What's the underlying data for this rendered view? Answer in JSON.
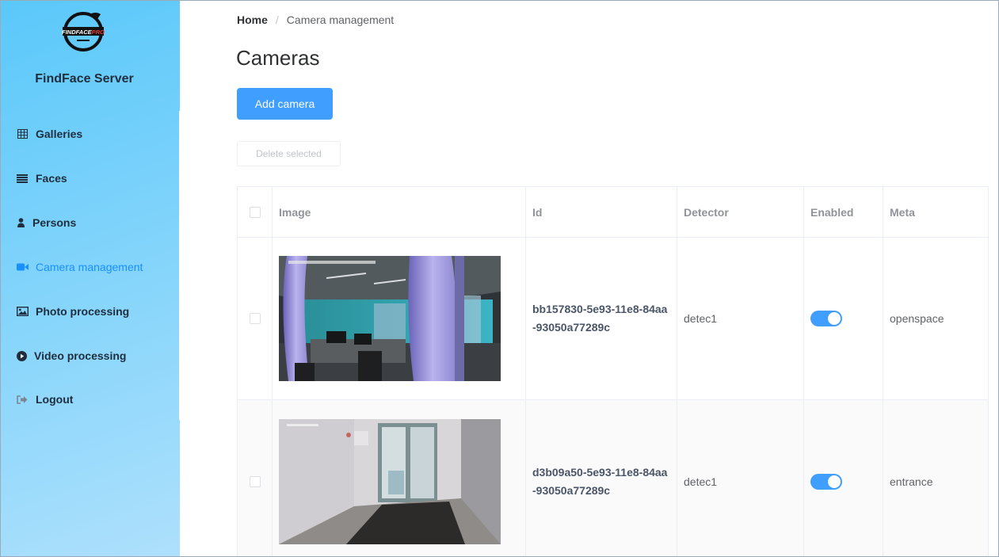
{
  "sidebar": {
    "logo_text": "FINDFACE PRO",
    "brand": "FindFace Server",
    "items": [
      {
        "label": "Galleries",
        "icon": "table-grid-icon",
        "active": false
      },
      {
        "label": "Faces",
        "icon": "list-icon",
        "active": false
      },
      {
        "label": "Persons",
        "icon": "person-icon",
        "active": false
      },
      {
        "label": "Camera management",
        "icon": "video-camera-icon",
        "active": true
      },
      {
        "label": "Photo processing",
        "icon": "image-icon",
        "active": false
      },
      {
        "label": "Video processing",
        "icon": "play-circle-icon",
        "active": false
      },
      {
        "label": "Logout",
        "icon": "sign-out-icon",
        "active": false
      }
    ]
  },
  "breadcrumb": {
    "home": "Home",
    "separator": "/",
    "current": "Camera management"
  },
  "page": {
    "title": "Cameras"
  },
  "actions": {
    "add_camera": "Add camera",
    "delete_selected": "Delete selected"
  },
  "table": {
    "columns": [
      "Image",
      "Id",
      "Detector",
      "Enabled",
      "Meta"
    ],
    "rows": [
      {
        "id": "bb157830-5e93-11e8-84aa-93050a77289c",
        "detector": "detec1",
        "enabled": true,
        "meta": "openspace",
        "image": "office-openspace-snapshot"
      },
      {
        "id": "d3b09a50-5e93-11e8-84aa-93050a77289c",
        "detector": "detec1",
        "enabled": true,
        "meta": "entrance",
        "image": "entrance-door-snapshot"
      }
    ]
  },
  "colors": {
    "accent": "#409eff",
    "sidebar_top": "#5ac8fa",
    "sidebar_bottom": "#aee0fc",
    "active_nav": "#1890ff"
  }
}
